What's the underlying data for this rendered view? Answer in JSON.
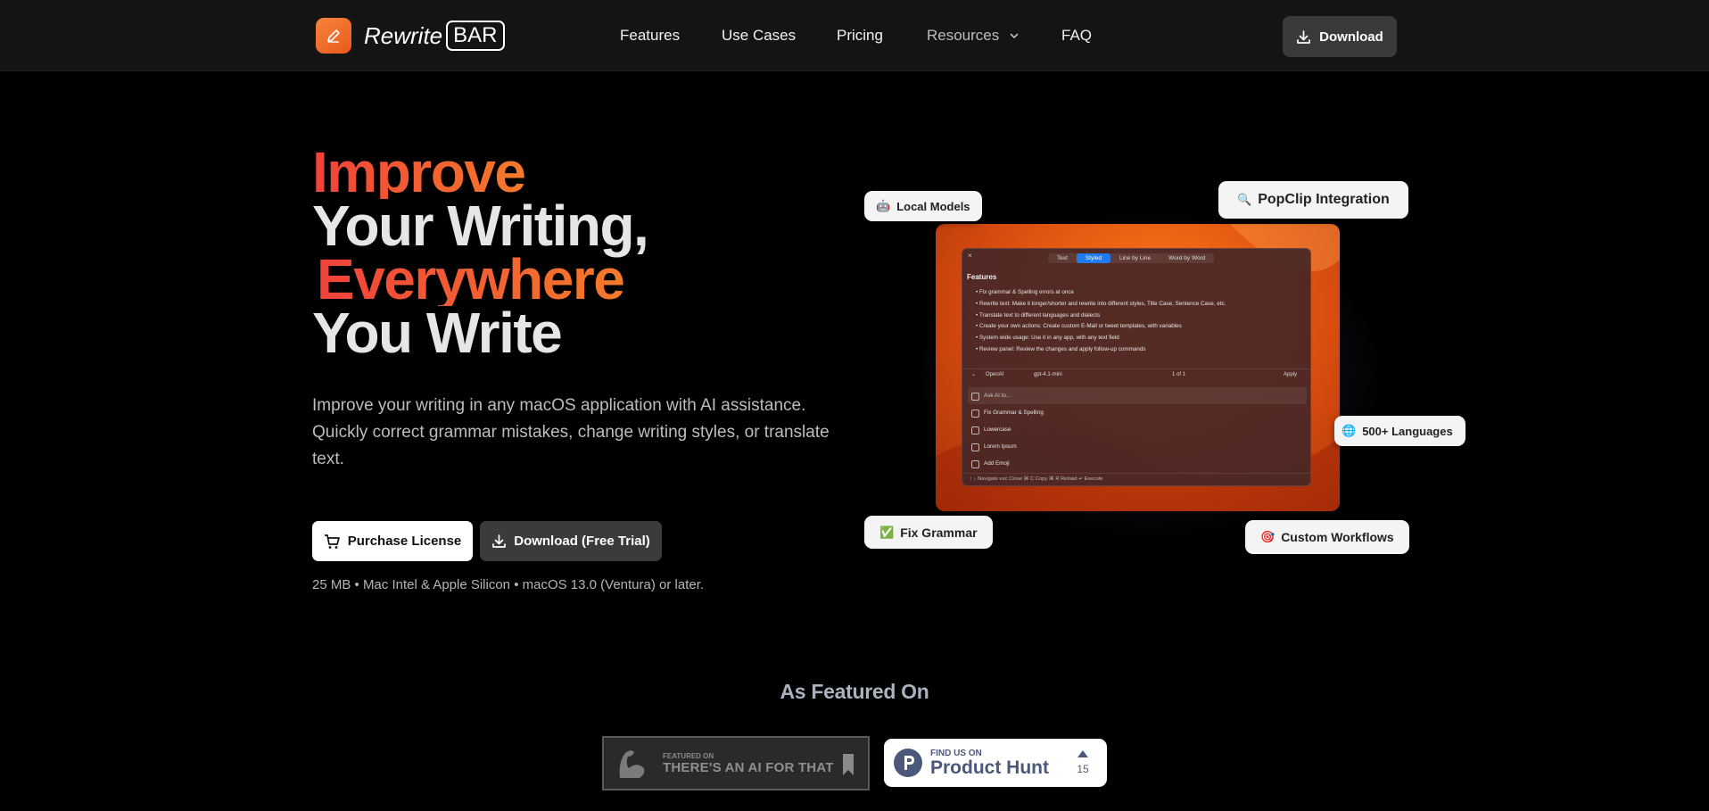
{
  "nav": {
    "brand_word": "Rewrite",
    "brand_box": "BAR",
    "links": [
      "Features",
      "Use Cases",
      "Pricing",
      "Resources",
      "FAQ"
    ],
    "download": "Download"
  },
  "hero": {
    "line1": "Improve",
    "line2": "Your Writing,",
    "line3": "Everywhere",
    "line4": "You Write",
    "subtitle": "Improve your writing in any macOS application with AI assistance. Quickly correct grammar mistakes, change writing styles, or translate text.",
    "buy_button": "Purchase License",
    "trial_button": "Download (Free Trial)",
    "meta": "25 MB • Mac Intel & Apple Silicon • macOS 13.0 (Ventura) or later."
  },
  "app_window": {
    "tabs": [
      "Text",
      "Styled",
      "Line by Line",
      "Word by Word"
    ],
    "heading": "Features",
    "items": [
      "Fix grammar & Spelling errors at once",
      "Rewrite text: Make it longer/shorter and rewrite into different styles, Title Case, Sentence Case, etc.",
      "Translate text to different languages and dialects",
      "Create your own actions: Create custom E-Mail or tweet templates, with variables",
      "System wide usage: Use it in any app, with any text field",
      "Review panel: Review the changes and apply follow-up commands"
    ],
    "provider": "OpenAI",
    "model": "gpt-4.1-mini",
    "counter": "1 of 1",
    "apply": "Apply",
    "menu": [
      "Ask AI to...",
      "Fix Grammar & Spelling",
      "Lowercase",
      "Lorem Ipsum",
      "Add Emoji"
    ],
    "footer": "↑ ↓ Navigate   esc Close   ⌘ C Copy   ⌘ R Reload   ↵ Execute"
  },
  "chips": {
    "local": "Local Models",
    "popclip": "PopClip Integration",
    "languages": "500+ Languages",
    "grammar": "Fix Grammar",
    "workflows": "Custom Workflows"
  },
  "featured": {
    "title": "As Featured On",
    "aift_small": "FEATURED ON",
    "aift_big": "THERE'S AN AI FOR THAT",
    "ph_small": "FIND US ON",
    "ph_big": "Product Hunt",
    "ph_votes": "15"
  }
}
